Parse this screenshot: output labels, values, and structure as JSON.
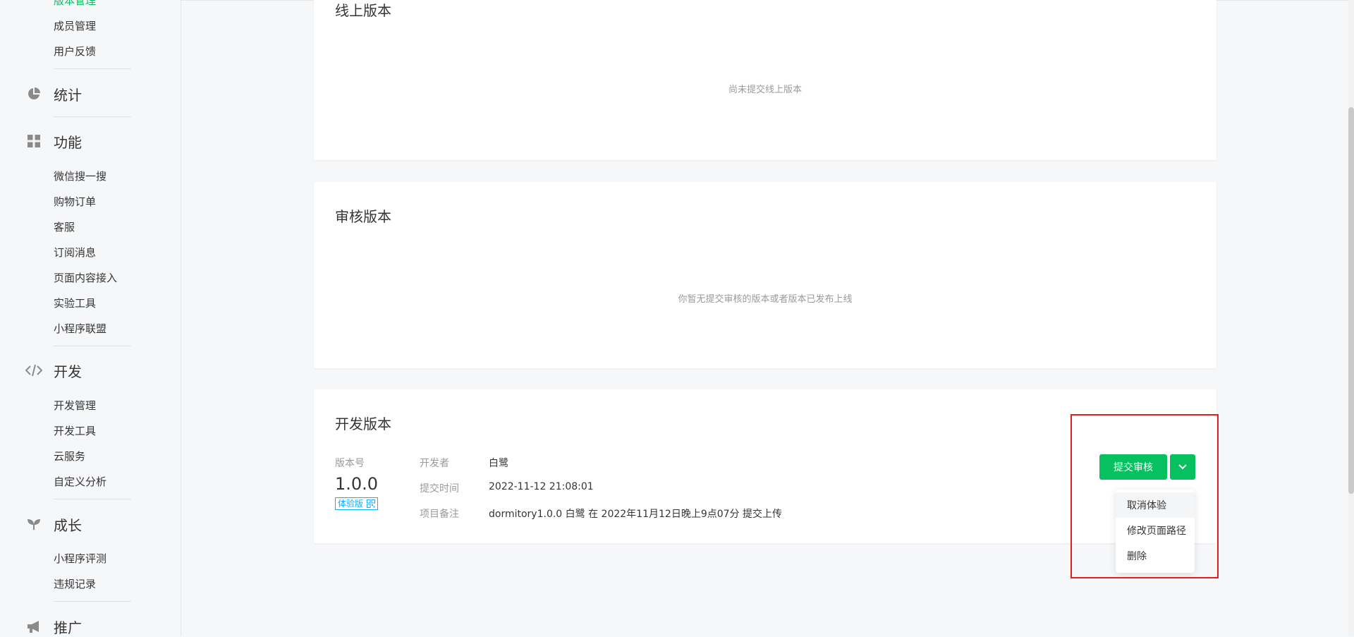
{
  "sidebar": {
    "top_items": [
      {
        "label": "版本管理"
      },
      {
        "label": "成员管理"
      },
      {
        "label": "用户反馈"
      }
    ],
    "categories": [
      {
        "label": "统计",
        "icon": "pie-chart-icon",
        "items": []
      },
      {
        "label": "功能",
        "icon": "grid-icon",
        "items": [
          "微信搜一搜",
          "购物订单",
          "客服",
          "订阅消息",
          "页面内容接入",
          "实验工具",
          "小程序联盟"
        ]
      },
      {
        "label": "开发",
        "icon": "code-icon",
        "items": [
          "开发管理",
          "开发工具",
          "云服务",
          "自定义分析"
        ]
      },
      {
        "label": "成长",
        "icon": "sprout-icon",
        "items": [
          "小程序评测",
          "违规记录"
        ]
      },
      {
        "label": "推广",
        "icon": "megaphone-icon",
        "items": []
      }
    ]
  },
  "online_version": {
    "title": "线上版本",
    "empty_text": "尚未提交线上版本"
  },
  "review_version": {
    "title": "审核版本",
    "empty_text": "你暂无提交审核的版本或者版本已发布上线"
  },
  "dev_version": {
    "title": "开发版本",
    "version_label": "版本号",
    "version_number": "1.0.0",
    "tag": "体验版",
    "developer_label": "开发者",
    "developer": "白鹭",
    "submit_time_label": "提交时间",
    "submit_time": "2022-11-12 21:08:01",
    "note_label": "项目备注",
    "note": "dormitory1.0.0 白鹭 在 2022年11月12日晚上9点07分 提交上传",
    "submit_button": "提交审核",
    "dropdown_items": [
      "取消体验",
      "修改页面路径",
      "删除"
    ]
  },
  "colors": {
    "brand_green": "#07c160",
    "tag_blue": "#10aeff",
    "highlight_red": "#e02020"
  }
}
